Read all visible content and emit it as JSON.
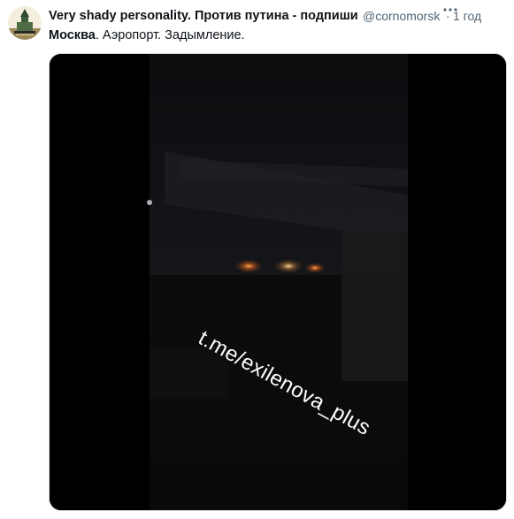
{
  "author": {
    "display_name": "Very shady personality. Против путина - подпиши",
    "handle": "@cornomorsk",
    "separator": "·",
    "time": "1 год",
    "avatar_icon": "avatar-kremlin-icon",
    "more_icon": "more-options-icon"
  },
  "tweet": {
    "hashtag": "Москва",
    "text_rest": ". Аэропорт. Задымление."
  },
  "media": {
    "watermark": "t.me/exilenova_plus"
  },
  "colors": {
    "text_primary": "#0f1419",
    "text_secondary": "#536471",
    "media_border": "#cfd9de"
  }
}
